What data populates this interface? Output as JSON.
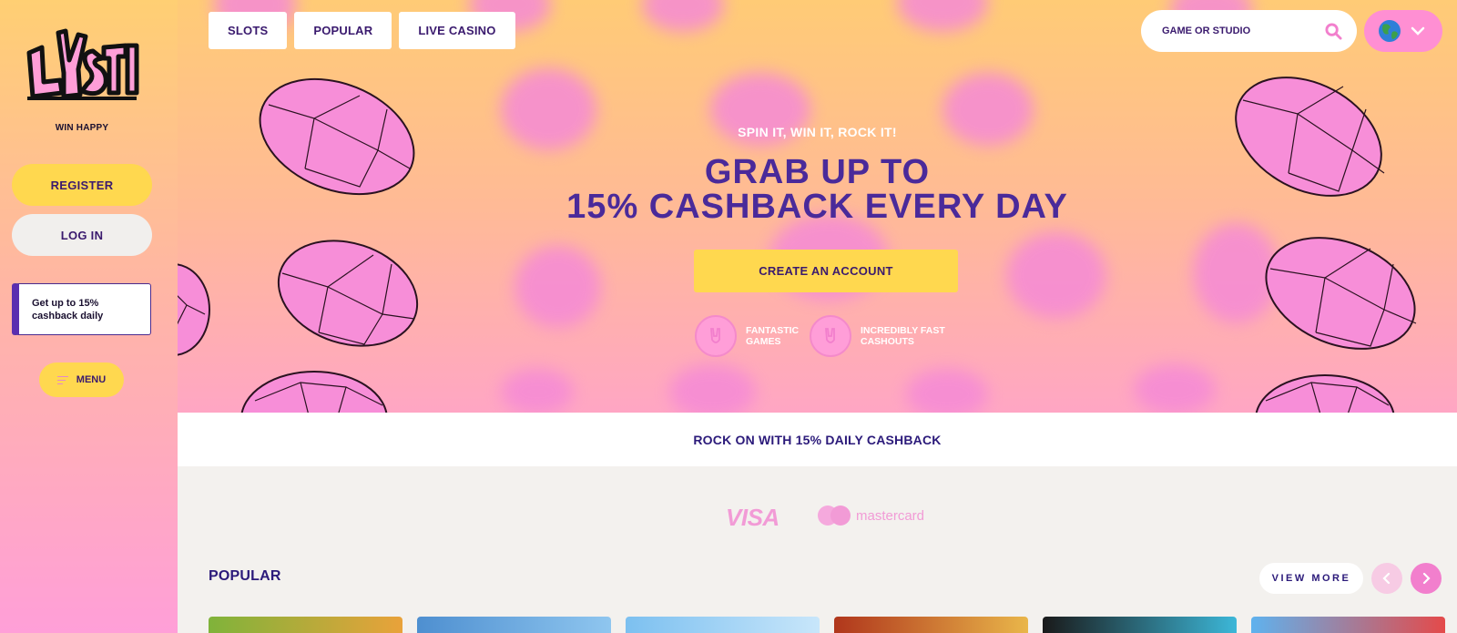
{
  "sidebar": {
    "logo_text": "LYSTI",
    "tagline": "WIN HAPPY",
    "register_label": "REGISTER",
    "login_label": "LOG IN",
    "promo_line1": "Get up to 15%",
    "promo_line2": "cashback daily",
    "menu_label": "MENU"
  },
  "top_nav": {
    "tabs": [
      {
        "label": "SLOTS"
      },
      {
        "label": "POPULAR"
      },
      {
        "label": "LIVE CASINO"
      }
    ],
    "search_placeholder": "GAME OR STUDIO"
  },
  "hero": {
    "eyebrow": "SPIN IT, WIN IT, ROCK IT!",
    "title_line1": "GRAB UP TO",
    "title_line2": "15% CASHBACK EVERY DAY",
    "cta_label": "CREATE AN ACCOUNT",
    "features": [
      {
        "line1": "FANTASTIC",
        "line2": "GAMES"
      },
      {
        "line1": "INCREDIBLY FAST",
        "line2": "CASHOUTS"
      }
    ]
  },
  "cashback_banner": "ROCK ON WITH 15% DAILY CASHBACK",
  "payments": {
    "visa": "VISA",
    "mastercard": "mastercard"
  },
  "popular": {
    "title": "POPULAR",
    "view_more_label": "VIEW MORE"
  },
  "colors": {
    "accent_yellow": "#ffd84f",
    "brand_purple": "#4a2a9a",
    "brand_pink": "#f27fcd"
  },
  "icons": {
    "search": "search-icon",
    "globe": "globe-icon",
    "chevron": "chevron-down-icon",
    "menu": "menu-icon",
    "prev": "chevron-left-icon",
    "next": "chevron-right-icon"
  }
}
